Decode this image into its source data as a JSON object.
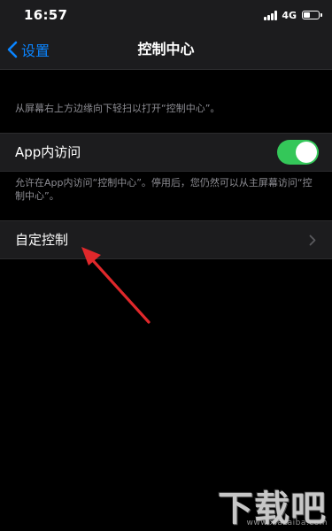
{
  "status_bar": {
    "time": "16:57",
    "network": "4G",
    "battery_level": 0.45
  },
  "nav": {
    "back_label": "设置",
    "title": "控制中心"
  },
  "description": "从屏幕右上方边缘向下轻扫以打开“控制中心”。",
  "app_access": {
    "label": "App内访问",
    "enabled": true,
    "footnote": "允许在App内访问“控制中心”。停用后，您仍然可以从主屏幕访问“控制中心”。"
  },
  "customize": {
    "label": "自定控制"
  },
  "watermark": {
    "main": "下载吧",
    "sub": "www.xiazaiba.com"
  },
  "colors": {
    "accent": "#0a84ff",
    "toggle_on": "#34c759",
    "annotation": "#e0282b"
  }
}
